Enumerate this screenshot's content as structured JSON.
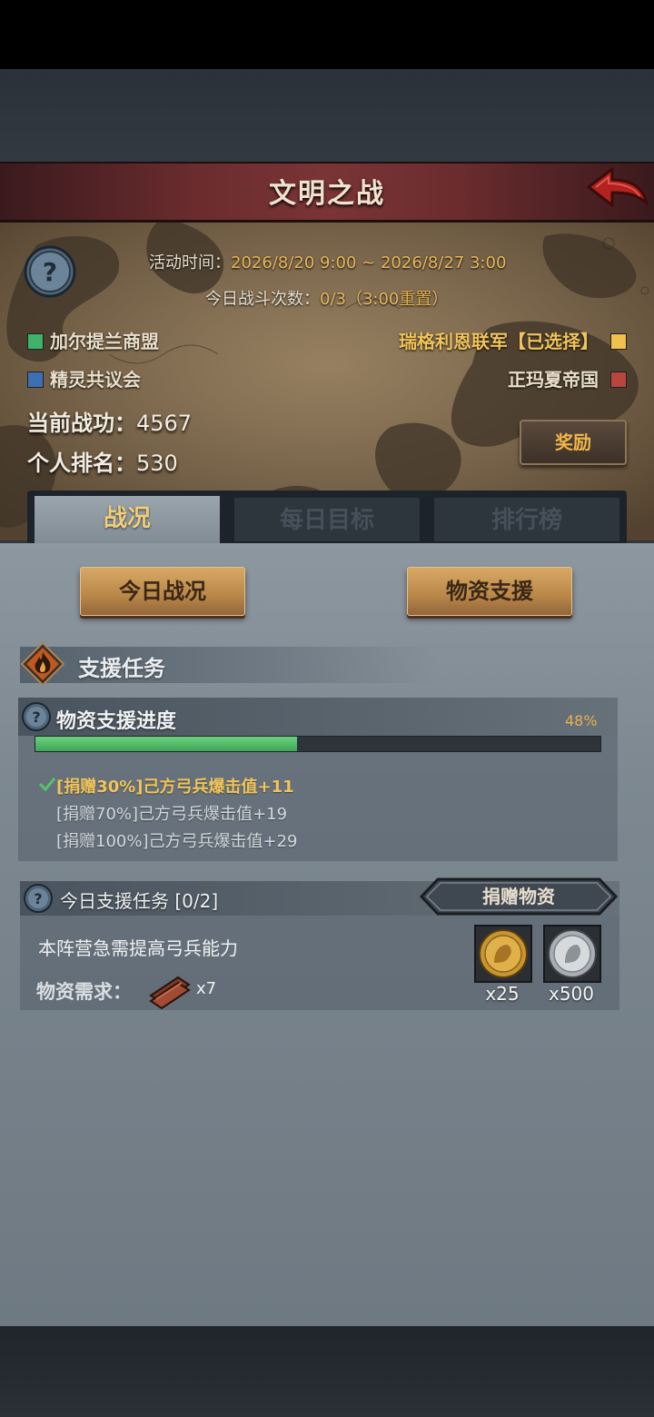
{
  "header": {
    "title": "文明之战"
  },
  "info": {
    "activity_time_label": "活动时间：",
    "activity_time_value": "2026/8/20 9:00 ~ 2026/8/27 3:00",
    "battles_label": "今日战斗次数：",
    "battles_value": "0/3（3:00",
    "battles_reset": "重置",
    "battles_close": "）"
  },
  "factions": [
    {
      "name": "加尔提兰商盟",
      "color": "#3fb36a"
    },
    {
      "name": "精灵共议会",
      "color": "#3d6fb5"
    },
    {
      "name": "瑞格利恩联军【已选择】",
      "color": "#f1c24b"
    },
    {
      "name": "正玛夏帝国",
      "color": "#b8453e"
    }
  ],
  "stats": {
    "merit_label": "当前战功：",
    "merit_value": "4567",
    "rank_label": "个人排名：",
    "rank_value": "530"
  },
  "reward_button": "奖励",
  "tabs": [
    {
      "label": "战况",
      "active": true
    },
    {
      "label": "每日目标",
      "active": false
    },
    {
      "label": "排行榜",
      "active": false
    }
  ],
  "sub_buttons": {
    "today": "今日战况",
    "support": "物资支援"
  },
  "section": {
    "title": "支援任务"
  },
  "progress": {
    "title": "物资支援进度",
    "percent_text": "48%",
    "fill_fraction": 0.48,
    "milestones": [
      {
        "text": "[捐赠30%]己方弓兵爆击值+11",
        "done": true
      },
      {
        "text": "[捐赠70%]己方弓兵爆击值+19",
        "done": false
      },
      {
        "text": "[捐赠100%]己方弓兵爆击值+29",
        "done": false
      }
    ]
  },
  "task": {
    "title": "今日支援任务 [0/2]",
    "donate_button": "捐赠物资",
    "description": "本阵营急需提高弓兵能力",
    "requirement_label": "物资需求：",
    "requirement_count": "x7",
    "rewards": [
      {
        "icon": "gold-coin-icon",
        "count": "x25"
      },
      {
        "icon": "silver-coin-icon",
        "count": "x500"
      }
    ]
  },
  "colors": {
    "accent": "#e8b85a",
    "progress": "#4cbd63",
    "banner": "#6b2c2e"
  }
}
